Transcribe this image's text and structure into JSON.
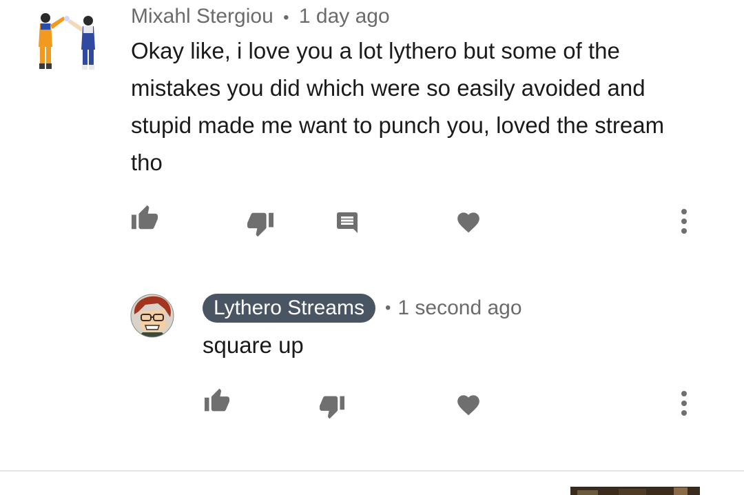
{
  "comment": {
    "author": "Mixahl Stergiou",
    "separator": "•",
    "timestamp": "1 day ago",
    "text": "Okay like, i love you a lot lythero but some of the mistakes you did which were so easily avoided and stupid made me want to punch you, loved the stream tho",
    "avatar_icon": "dragon-ball-characters-avatar",
    "actions": [
      "thumbs-up-icon",
      "thumbs-down-icon",
      "reply-icon",
      "heart-icon",
      "more-vert-icon"
    ]
  },
  "reply": {
    "author": "Lythero Streams",
    "separator": "•",
    "timestamp": "1 second ago",
    "text": "square up",
    "avatar_icon": "cartoon-face-avatar",
    "actions": [
      "thumbs-up-icon",
      "thumbs-down-icon",
      "heart-icon",
      "more-vert-icon"
    ]
  },
  "colors": {
    "icon_gray": "#6f6f6f",
    "author_chip_bg": "#4a5563",
    "text": "#1a1a1a",
    "meta": "#6b6b6b"
  }
}
